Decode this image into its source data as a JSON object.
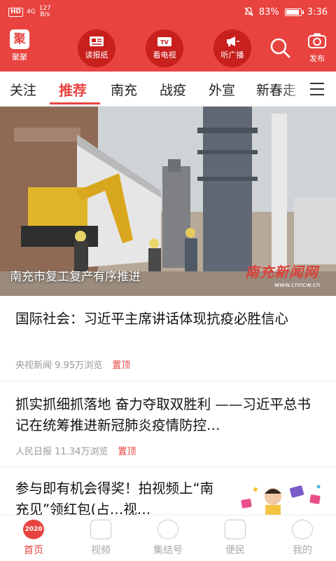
{
  "status_bar": {
    "hd": "HD",
    "network": "4G",
    "speed_value": "127",
    "speed_unit": "B/s",
    "battery": "83%",
    "battery_level": 0.83,
    "time": "3:36"
  },
  "header": {
    "logo_label": "聚聚",
    "logo_mark": "聚",
    "buttons": [
      {
        "label": "读报纸",
        "icon": "newspaper-icon"
      },
      {
        "label": "看电视",
        "icon": "tv-icon"
      },
      {
        "label": "听广播",
        "icon": "megaphone-icon"
      }
    ],
    "tv_badge": "TV",
    "publish_label": "发布"
  },
  "tabs": {
    "items": [
      "关注",
      "推荐",
      "南充",
      "战疫",
      "外宣",
      "新春走"
    ],
    "active": "推荐"
  },
  "hero": {
    "caption": "南充市复工复产有序推进",
    "watermark": "南充新闻网",
    "watermark_url": "www.cnncw.cn"
  },
  "news": [
    {
      "title": "国际社会：习近平主席讲话体现抗疫必胜信心",
      "source": "央视新闻",
      "views": "9.95万浏览",
      "pin": "置顶"
    },
    {
      "title": "抓实抓细抓落地 奋力夺取双胜利 ——习近平总书记在统筹推进新冠肺炎疫情防控…",
      "source": "人民日报",
      "views": "11.34万浏览",
      "pin": "置顶"
    },
    {
      "title": "参与即有机会得奖！拍视频上“南充见”领红包(占…视…"
    }
  ],
  "bottom_nav": {
    "items": [
      "首页",
      "视频",
      "集结号",
      "便民",
      "我的"
    ],
    "active": "首页",
    "home_badge": "2020"
  },
  "colors": {
    "brand": "#e8433f",
    "brand_dark": "#c8201d"
  }
}
